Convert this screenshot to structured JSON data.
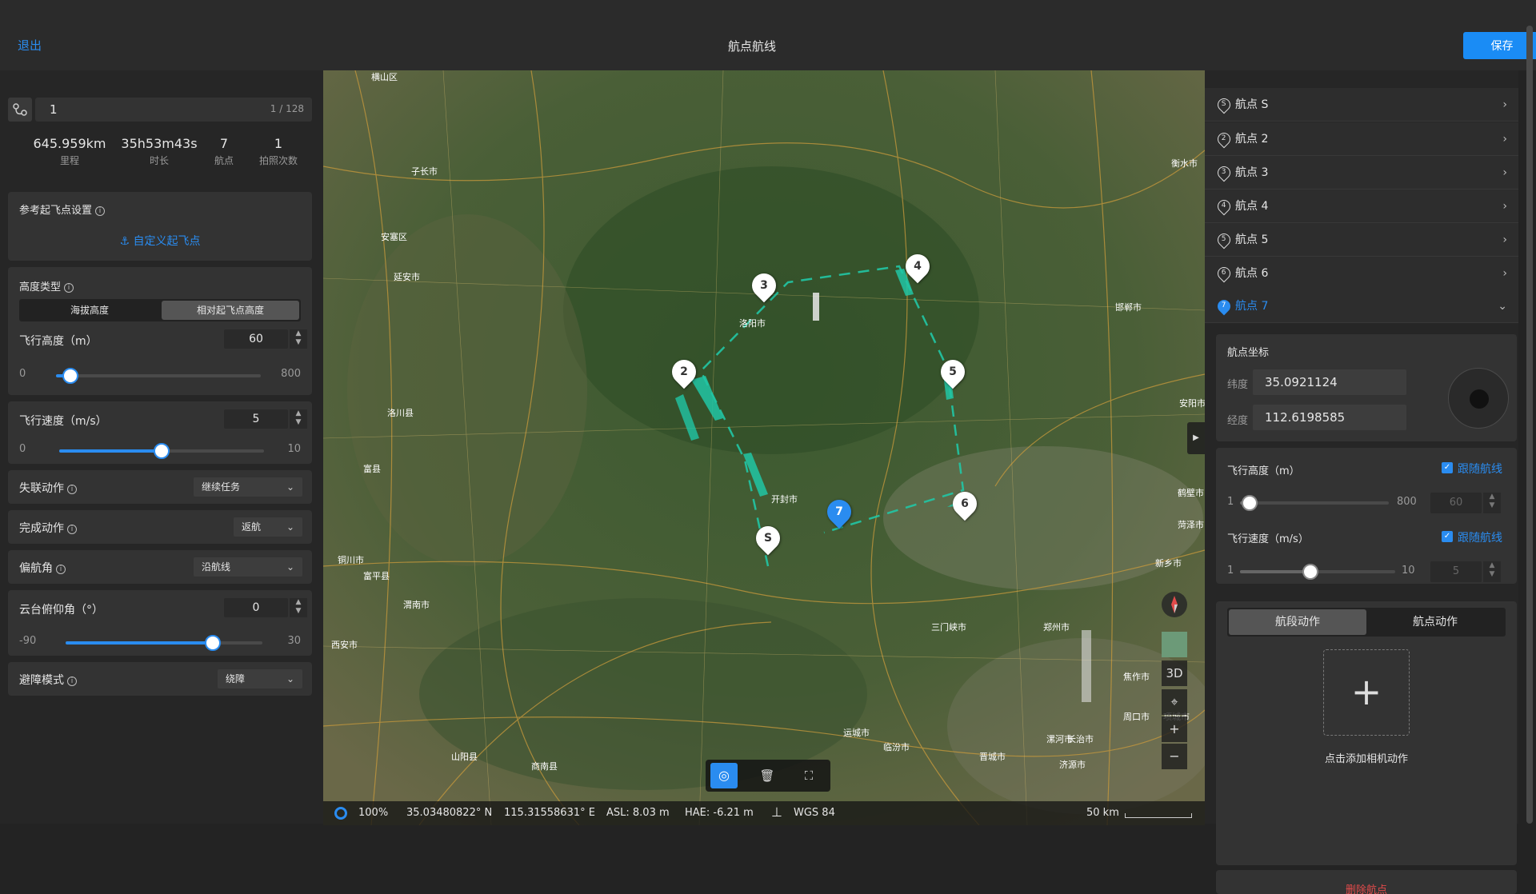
{
  "header": {
    "exit_label": "退出",
    "title": "航点航线",
    "save_label": "保存"
  },
  "left": {
    "route_name": "1",
    "route_count": "1 / 128",
    "stats": [
      {
        "value": "645.959km",
        "label": "里程"
      },
      {
        "value": "35h53m43s",
        "label": "时长"
      },
      {
        "value": "7",
        "label": "航点"
      },
      {
        "value": "1",
        "label": "拍照次数"
      }
    ],
    "takeoff_title": "参考起飞点设置",
    "takeoff_link": "自定义起飞点",
    "height_type_title": "高度类型",
    "height_type_options": [
      "海拔高度",
      "相对起飞点高度"
    ],
    "height_type_selected": 1,
    "flight_height_label": "飞行高度（m）",
    "flight_height_value": "60",
    "flight_height_min": "0",
    "flight_height_max": "800",
    "flight_height_fraction": 0.075,
    "flight_speed_label": "飞行速度（m/s）",
    "flight_speed_value": "5",
    "flight_speed_min": "0",
    "flight_speed_max": "10",
    "flight_speed_fraction": 0.5,
    "lost_action_label": "失联动作",
    "lost_action_value": "继续任务",
    "finish_action_label": "完成动作",
    "finish_action_value": "返航",
    "yaw_label": "偏航角",
    "yaw_value": "沿航线",
    "gimbal_label": "云台俯仰角（°）",
    "gimbal_value": "0",
    "gimbal_min": "-90",
    "gimbal_max": "30",
    "gimbal_fraction": 0.75,
    "avoid_label": "避障模式",
    "avoid_value": "绕障"
  },
  "map": {
    "waypoints": [
      {
        "label": "S",
        "selected": false
      },
      {
        "label": "2",
        "selected": false
      },
      {
        "label": "3",
        "selected": false
      },
      {
        "label": "4",
        "selected": false
      },
      {
        "label": "5",
        "selected": false
      },
      {
        "label": "6",
        "selected": false
      },
      {
        "label": "7",
        "selected": true
      }
    ],
    "controls": {
      "three_d": "3D"
    },
    "places": [
      "横山区",
      "子长市",
      "安塞区",
      "延安市",
      "洛川县",
      "富县",
      "铜川市",
      "富平县",
      "西安市",
      "渭南市",
      "山阳县",
      "商南县",
      "运城市",
      "临汾市",
      "晋城市",
      "长治市",
      "济源市",
      "焦作市",
      "新乡市",
      "鹤壁市",
      "安阳市",
      "邯郸市",
      "衡水市",
      "菏泽市",
      "周口市",
      "漯河市",
      "项城市",
      "洛阳市",
      "三门峡市",
      "郑州市",
      "开封市"
    ],
    "colors": {
      "route": "#21c6a5",
      "selected": "#2a8cf0"
    }
  },
  "status": {
    "zoom": "100%",
    "lat": "35.03480822° N",
    "lon": "115.31558631° E",
    "asl": "ASL: 8.03 m",
    "hae": "HAE: -6.21 m",
    "datum": "WGS 84",
    "scale": "50 km"
  },
  "right": {
    "waypoint_rows": [
      {
        "num": "S",
        "label": "航点 S"
      },
      {
        "num": "2",
        "label": "航点 2"
      },
      {
        "num": "3",
        "label": "航点 3"
      },
      {
        "num": "4",
        "label": "航点 4"
      },
      {
        "num": "5",
        "label": "航点 5"
      },
      {
        "num": "6",
        "label": "航点 6"
      }
    ],
    "selected_row": {
      "num": "7",
      "label": "航点 7"
    },
    "coord_title": "航点坐标",
    "lat_label": "纬度",
    "lat_value": "35.0921124",
    "lon_label": "经度",
    "lon_value": "112.6198585",
    "height_label": "飞行高度（m）",
    "follow_label": "跟随航线",
    "height_min": "1",
    "height_max": "800",
    "height_value": "60",
    "height_fraction": 0.07,
    "speed_label": "飞行速度（m/s）",
    "speed_min": "1",
    "speed_max": "10",
    "speed_value": "5",
    "speed_fraction": 0.45,
    "tabs": [
      "航段动作",
      "航点动作"
    ],
    "add_action_label": "点击添加相机动作",
    "delete_label": "删除航点"
  }
}
